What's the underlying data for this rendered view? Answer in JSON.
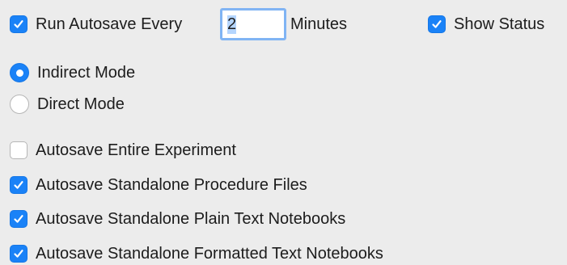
{
  "autosave": {
    "run_label": "Run Autosave Every",
    "run_checked": true,
    "minutes_value": "2",
    "minutes_label": "Minutes",
    "show_status_label": "Show Status",
    "show_status_checked": true
  },
  "mode": {
    "options": [
      {
        "label": "Indirect Mode",
        "selected": true
      },
      {
        "label": "Direct Mode",
        "selected": false
      }
    ]
  },
  "options": {
    "entire_experiment": {
      "label": "Autosave Entire Experiment",
      "checked": false
    },
    "procedure_files": {
      "label": "Autosave Standalone Procedure Files",
      "checked": true
    },
    "plain_text": {
      "label": "Autosave Standalone Plain Text Notebooks",
      "checked": true
    },
    "formatted_text": {
      "label": "Autosave Standalone Formatted Text Notebooks",
      "checked": true
    }
  },
  "colors": {
    "accent": "#1a82f7",
    "background": "#ececec"
  }
}
